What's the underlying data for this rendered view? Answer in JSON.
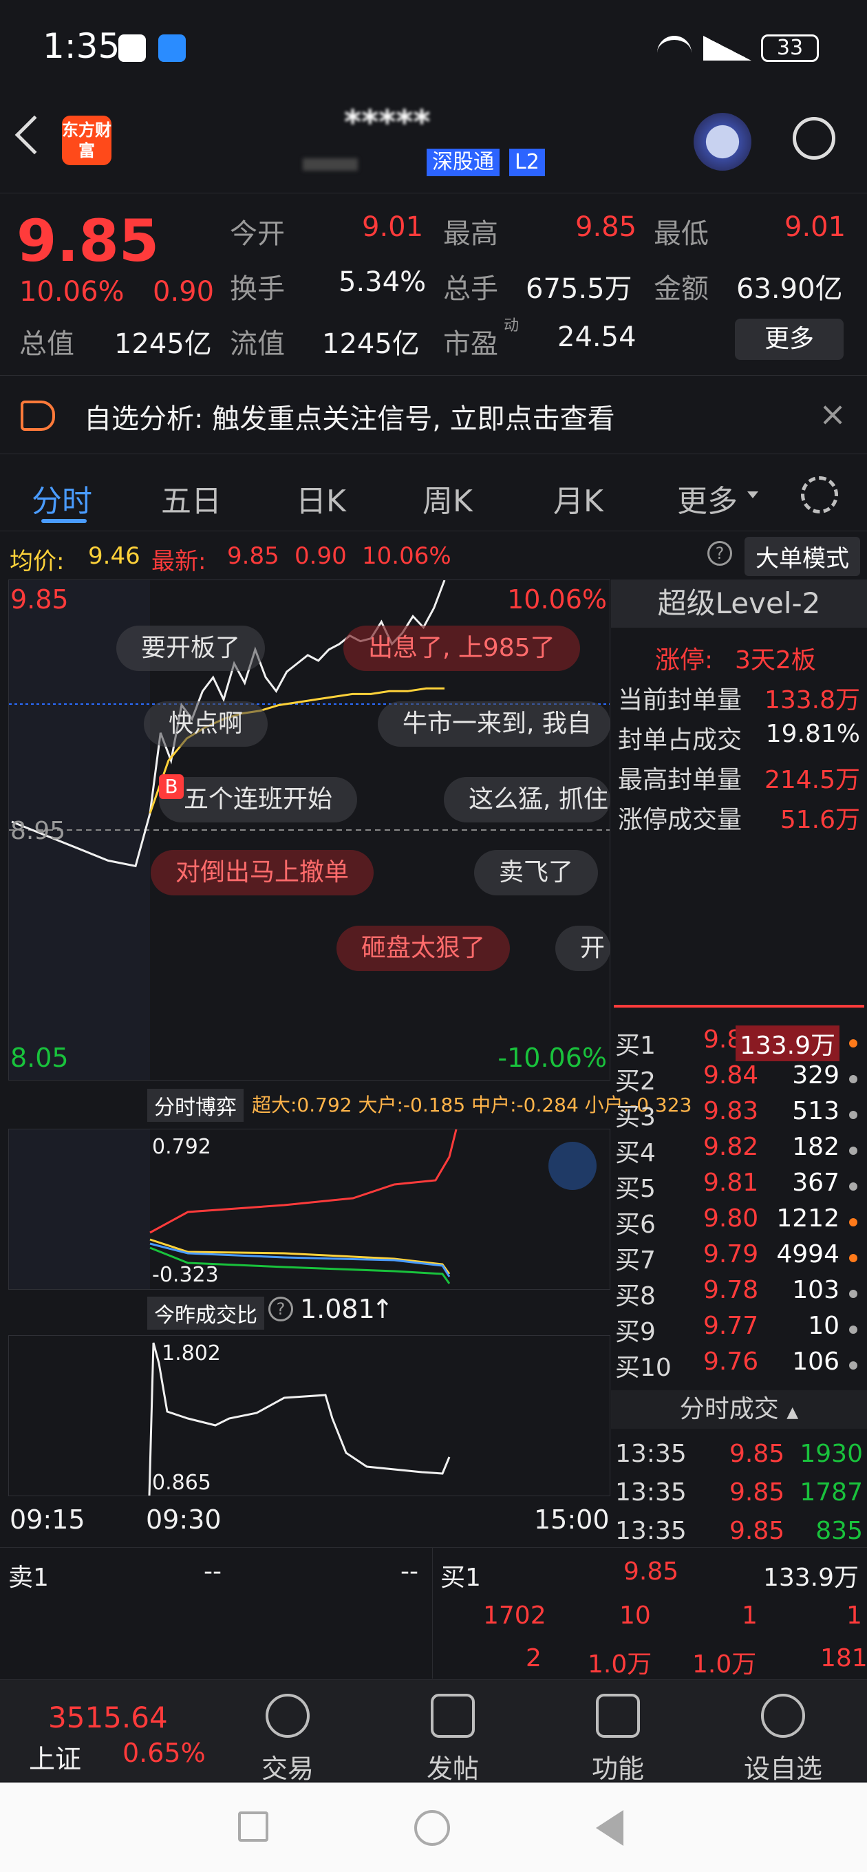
{
  "status_bar": {
    "time": "1:35",
    "battery": "33"
  },
  "header": {
    "logo_text": "东方财富",
    "stock_name": "*****",
    "tag": "深股通",
    "tag2": "L2"
  },
  "quote": {
    "price": "9.85",
    "change_pct": "10.06%",
    "change": "0.90",
    "open_label": "今开",
    "open": "9.01",
    "high_label": "最高",
    "high": "9.85",
    "low_label": "最低",
    "low": "9.01",
    "turnover_label": "换手",
    "turnover": "5.34%",
    "volume_label": "总手",
    "volume": "675.5万",
    "amount_label": "金额",
    "amount": "63.90亿",
    "total_cap_label": "总值",
    "total_cap": "1245亿",
    "float_cap_label": "流值",
    "float_cap": "1245亿",
    "pe_label": "市盈",
    "pe_super": "动",
    "pe": "24.54",
    "more": "更多"
  },
  "notice": {
    "text": "自选分析: 触发重点关注信号, 立即点击查看"
  },
  "tabs": [
    "分时",
    "五日",
    "日K",
    "周K",
    "月K",
    "更多"
  ],
  "chart_info": {
    "avg_label": "均价:",
    "avg": "9.46",
    "last_label": "最新:",
    "last": "9.85",
    "chg": "0.90",
    "pct": "10.06%",
    "big_order_mode": "大单模式"
  },
  "chart_data": {
    "type": "line",
    "y_high": "9.85",
    "y_mid": "8.95",
    "y_low": "8.05",
    "pct_high": "10.06%",
    "pct_low": "-10.06%",
    "x_labels": [
      "09:15",
      "09:30",
      "15:00"
    ],
    "price": [
      8.98,
      8.96,
      8.94,
      8.92,
      8.9,
      8.88,
      8.86,
      8.84,
      8.83,
      8.82,
      9.01,
      9.3,
      9.2,
      9.4,
      9.35,
      9.45,
      9.5,
      9.42,
      9.55,
      9.48,
      9.6,
      9.5,
      9.45,
      9.52,
      9.55,
      9.58,
      9.56,
      9.6,
      9.62,
      9.65,
      9.63,
      9.64,
      9.7,
      9.62,
      9.66,
      9.72,
      9.68,
      9.75,
      9.85
    ],
    "avg": [
      9.01,
      9.2,
      9.28,
      9.32,
      9.35,
      9.37,
      9.38,
      9.4,
      9.41,
      9.42,
      9.43,
      9.44,
      9.44,
      9.45,
      9.45,
      9.46,
      9.46
    ]
  },
  "danmu": [
    "要开板了",
    "出息了, 上985了",
    "牛市一来到, 我自",
    "快点啊",
    "五个连班开始",
    "这么猛, 抓住",
    "对倒出马上撤单",
    "卖飞了",
    "砸盘太狠了",
    "开"
  ],
  "level2": {
    "title": "超级Level-2",
    "limit_label": "涨停:",
    "limit_value": "3天2板",
    "rows": [
      {
        "label": "当前封单量",
        "value": "133.8万"
      },
      {
        "label": "封单占成交",
        "value": "19.81%"
      },
      {
        "label": "最高封单量",
        "value": "214.5万"
      },
      {
        "label": "涨停成交量",
        "value": "51.6万"
      }
    ]
  },
  "order_book": [
    {
      "label": "买1",
      "price": "9.85",
      "vol": "133.9万"
    },
    {
      "label": "买2",
      "price": "9.84",
      "vol": "329"
    },
    {
      "label": "买3",
      "price": "9.83",
      "vol": "513"
    },
    {
      "label": "买4",
      "price": "9.82",
      "vol": "182"
    },
    {
      "label": "买5",
      "price": "9.81",
      "vol": "367"
    },
    {
      "label": "买6",
      "price": "9.80",
      "vol": "1212"
    },
    {
      "label": "买7",
      "price": "9.79",
      "vol": "4994"
    },
    {
      "label": "买8",
      "price": "9.78",
      "vol": "103"
    },
    {
      "label": "买9",
      "price": "9.77",
      "vol": "10"
    },
    {
      "label": "买10",
      "price": "9.76",
      "vol": "106"
    }
  ],
  "ticks": {
    "title": "分时成交",
    "rows": [
      {
        "time": "13:35",
        "price": "9.85",
        "vol": "1930"
      },
      {
        "time": "13:35",
        "price": "9.85",
        "vol": "1787"
      },
      {
        "time": "13:35",
        "price": "9.85",
        "vol": "835"
      }
    ]
  },
  "sub1": {
    "selector": "分时博弈",
    "legend": "超大:0.792 大户:-0.185 中户:-0.284 小户:-0.323",
    "top": "0.792",
    "bottom": "-0.323"
  },
  "sub2": {
    "selector": "今昨成交比",
    "value": "1.081",
    "top": "1.802",
    "bottom": "0.865"
  },
  "bottom_book": {
    "sell1": "卖1",
    "sell_dash1": "--",
    "sell_dash2": "--",
    "buy1": "买1",
    "buy_price": "9.85",
    "buy_vol": "133.9万",
    "r1": [
      "1702",
      "10",
      "1",
      "1"
    ],
    "r2": [
      "2",
      "1.0万",
      "1.0万",
      "181"
    ]
  },
  "bottom_nav": {
    "index_value": "3515.64",
    "index_name": "上证",
    "index_pct": "0.65%",
    "items": [
      "交易",
      "发帖",
      "功能",
      "设自选"
    ]
  }
}
